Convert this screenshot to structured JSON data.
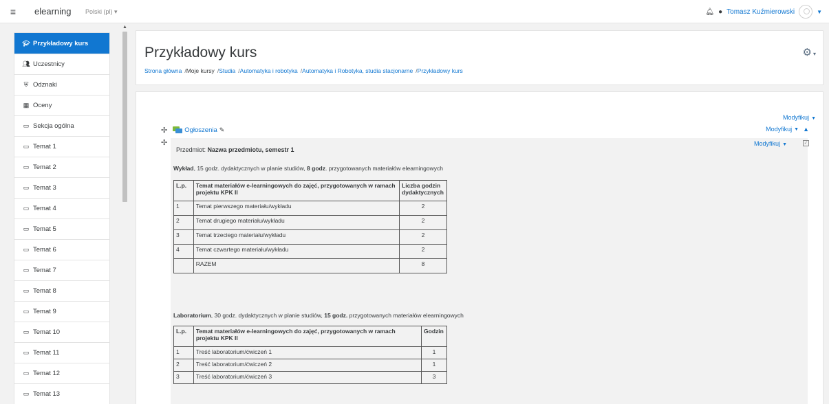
{
  "navbar": {
    "menu_icon": "hamburger-icon",
    "site_name": "elearning",
    "language": "Polski (pl) ▾",
    "user_name": "Tomasz Kuźmierowski"
  },
  "sidebar": {
    "items": [
      {
        "label": "Przykładowy kurs",
        "icon": "graduation-cap-icon",
        "active": true
      },
      {
        "label": "Uczestnicy",
        "icon": "users-icon"
      },
      {
        "label": "Odznaki",
        "icon": "shield-icon"
      },
      {
        "label": "Oceny",
        "icon": "table-icon"
      },
      {
        "label": "Sekcja ogólna",
        "icon": "folder-icon"
      },
      {
        "label": "Temat 1",
        "icon": "folder-icon"
      },
      {
        "label": "Temat 2",
        "icon": "folder-icon"
      },
      {
        "label": "Temat 3",
        "icon": "folder-icon"
      },
      {
        "label": "Temat 4",
        "icon": "folder-icon"
      },
      {
        "label": "Temat 5",
        "icon": "folder-icon"
      },
      {
        "label": "Temat 6",
        "icon": "folder-icon"
      },
      {
        "label": "Temat 7",
        "icon": "folder-icon"
      },
      {
        "label": "Temat 8",
        "icon": "folder-icon"
      },
      {
        "label": "Temat 9",
        "icon": "folder-icon"
      },
      {
        "label": "Temat 10",
        "icon": "folder-icon"
      },
      {
        "label": "Temat 11",
        "icon": "folder-icon"
      },
      {
        "label": "Temat 12",
        "icon": "folder-icon"
      },
      {
        "label": "Temat 13",
        "icon": "folder-icon"
      }
    ]
  },
  "header": {
    "title": "Przykładowy kurs",
    "breadcrumb": [
      {
        "label": "Strona główna",
        "link": true
      },
      {
        "label": "Moje kursy",
        "link": false
      },
      {
        "label": "Studia",
        "link": true
      },
      {
        "label": "Automatyka i robotyka",
        "link": true
      },
      {
        "label": "Automatyka i Robotyka, studia stacjonarne",
        "link": true
      },
      {
        "label": "Przykładowy kurs",
        "link": true
      }
    ]
  },
  "main": {
    "modify_label": "Modyfikuj",
    "announcements_label": "Ogłoszenia",
    "subject_prefix": "Przedmiot: ",
    "subject_name": "Nazwa przedmiotu, semestr 1",
    "lecture": {
      "name": "Wykład",
      "text_a": ", 15 godz. dydaktycznych w planie studiów, ",
      "hours": "8 godz",
      "text_b": ". przygotowanych materiałów elearningowych",
      "headers": [
        "L.p.",
        "Temat materiałów e-learningowych do zajęć,  przygotowanych w ramach projektu KPK II",
        "Liczba godzin dydaktycznych"
      ],
      "rows": [
        [
          "1",
          "Temat pierwszego materiału/wykładu",
          "2"
        ],
        [
          "2",
          "Temat drugiego materiału/wykładu",
          "2"
        ],
        [
          "3",
          "Temat trzeciego materiału/wykładu",
          "2"
        ],
        [
          "4",
          "Temat czwartego materiału/wykładu",
          "2"
        ],
        [
          "",
          "RAZEM",
          "8"
        ]
      ]
    },
    "lab": {
      "name": "Laboratorium",
      "text_a": ", 30 godz. dydaktycznych w planie studiów, ",
      "hours": "15 godz.",
      "text_b": " przygotowanych materiałów elearningowych",
      "headers": [
        "L.p.",
        "Temat materiałów e-learningowych do zajęć, przygotowanych w ramach projektu KPK II",
        "Godzin"
      ],
      "rows": [
        [
          "1",
          "Treść laboratorium/ćwiczeń 1",
          "1"
        ],
        [
          "2",
          "Treść laboratorium/ćwiczeń 2",
          "1"
        ],
        [
          "3",
          "Treść laboratorium/ćwiczeń 3",
          "3"
        ]
      ]
    }
  }
}
